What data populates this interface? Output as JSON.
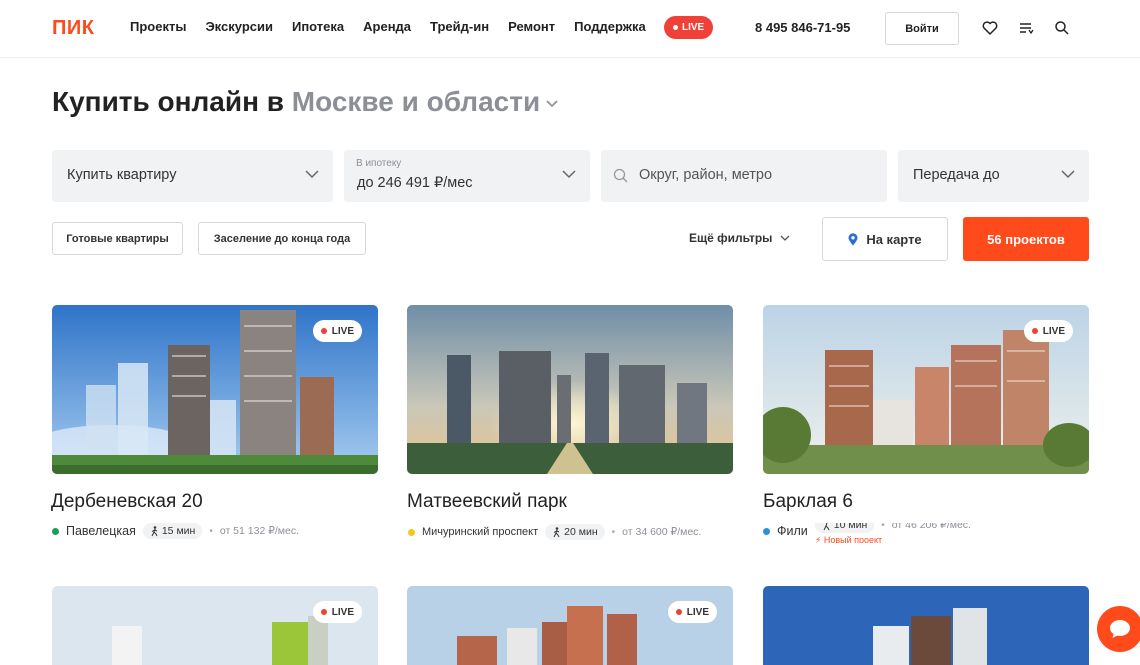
{
  "header": {
    "logo": "ПИК",
    "nav": [
      "Проекты",
      "Экскурсии",
      "Ипотека",
      "Аренда",
      "Трейд-ин",
      "Ремонт",
      "Поддержка"
    ],
    "live_label": "LIVE",
    "phone": "8 495 846-71-95",
    "login_label": "Войти",
    "icons": [
      "heart-icon",
      "menu-icon",
      "search-icon"
    ]
  },
  "title": {
    "prefix": "Купить онлайн в",
    "city": "Москве и области"
  },
  "filters": {
    "type_value": "Купить квартиру",
    "mortgage_label": "В ипотеку",
    "mortgage_value": "до 246 491 ₽/мес",
    "location_placeholder": "Округ, район, метро",
    "handover_value": "Передача до",
    "chip_ready": "Готовые квартиры",
    "chip_settle": "Заселение до конца года",
    "more_filters": "Ещё фильтры",
    "map_button": "На карте",
    "projects_button": "56 проектов"
  },
  "cards": [
    {
      "title": "Дербеневская 20",
      "metro": "Павелецкая",
      "metro_color": "#1a9e57",
      "walk": "15 мин",
      "price": "от 51 132 ₽/мес.",
      "live": "LIVE"
    },
    {
      "title": "Матвеевский парк",
      "metro": "Мичуринский проспект",
      "metro_color": "#f5c518",
      "walk": "20 мин",
      "price": "от 34 600 ₽/мес.",
      "live": ""
    },
    {
      "title": "Барклая 6",
      "metro": "Фили",
      "metro_color": "#2b8fd6",
      "walk": "10 мин",
      "price": "от 46 206 ₽/мес.",
      "badge": "Новый проект",
      "live": "LIVE"
    },
    {
      "live": "LIVE"
    },
    {
      "live": "LIVE"
    },
    {
      "live": ""
    }
  ],
  "colors": {
    "brand": "#ff4a1c",
    "live": "#ef4138",
    "muted": "#8c8f96",
    "field_bg": "#f1f2f4"
  }
}
